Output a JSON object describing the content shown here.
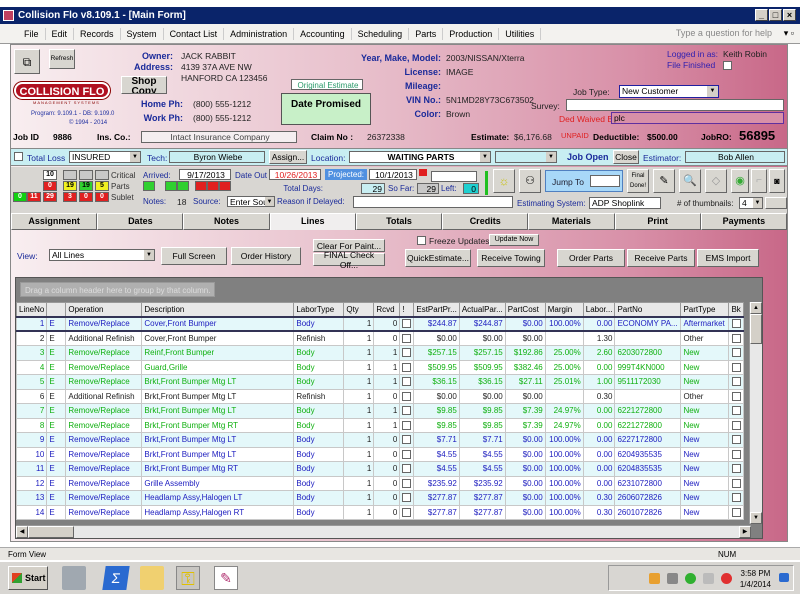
{
  "window": {
    "title": "Collision Flo v8.109.1 - [Main Form]",
    "controls": [
      "_",
      "□",
      "×"
    ]
  },
  "menu": {
    "items": [
      "File",
      "Edit",
      "Records",
      "System",
      "Contact List",
      "Administration",
      "Accounting",
      "Scheduling",
      "Parts",
      "Production",
      "Utilities"
    ],
    "help_placeholder": "Type a question for help"
  },
  "header": {
    "refresh_label": "Refresh",
    "shop_copy_label": "Shop Copy",
    "logo_text": "COLLISION FLO",
    "logo_sub": "MANAGEMENT SYSTEMS",
    "program_info": "Program: 9.109.1 - DB: 9.109.0",
    "copyright": "© 1994 - 2014",
    "owner_label": "Owner:",
    "owner": "JACK RABBIT",
    "address_label": "Address:",
    "address1": "4139 37A AVE NW",
    "address2": "HANFORD CA 123456",
    "home_ph_label": "Home Ph:",
    "home_ph": "(800) 555-1212",
    "work_ph_label": "Work Ph:",
    "work_ph": "(800) 555-1212",
    "job_id_label": "Job ID",
    "job_id": "9886",
    "ins_co_label": "Ins. Co.:",
    "ins_co": "Intact Insurance Company",
    "original_estimate_label": "Original Estimate",
    "date_promised_label": "Date Promised",
    "ymm_label": "Year, Make, Model:",
    "ymm": "2003/NISSAN/Xterra",
    "license_label": "License:",
    "license": "IMAGE",
    "mileage_label": "Mileage:",
    "mileage": "",
    "vin_label": "VIN No.:",
    "vin": "5N1MD28Y73C673502",
    "color_label": "Color:",
    "color": "Brown",
    "claim_label": "Claim No :",
    "claim": "26372338",
    "estimate_label": "Estimate:",
    "estimate": "$6,176.68",
    "unpaid": "UNPAID",
    "deductible_label": "Deductible:",
    "deductible": "$500.00",
    "jobro_label": "JobRO:",
    "jobro": "56895",
    "logged_in_label": "Logged in as:",
    "logged_in_user": "Keith Robin",
    "file_finished_label": "File Finished",
    "job_type_label": "Job Type:",
    "job_type": "New Customer",
    "survey_label": "Survey:",
    "survey": "",
    "ded_waived_label": "Ded Waived By:",
    "ded_waived": "plc"
  },
  "status_band": {
    "total_loss_label": "Total Loss",
    "insured": "INSURED",
    "tech_label": "Tech:",
    "tech": "Byron Wiebe",
    "assign_label": "Assign...",
    "location_label": "Location:",
    "location": "WAITING PARTS",
    "location2": "",
    "job_open": "Job Open",
    "close_label": "Close",
    "estimator_label": "Estimator:",
    "estimator": "Bob Allen"
  },
  "counts": {
    "top": "10",
    "red1": "0",
    "green": "0",
    "red2": "11",
    "red3": "29",
    "yellow": [
      "19",
      "19",
      "5"
    ],
    "red_row": [
      "3",
      "0",
      "0"
    ],
    "critical_label": "Critical",
    "parts_label": "Parts",
    "sublet_label": "Sublet"
  },
  "dates": {
    "arrived_label": "Arrived:",
    "arrived": "9/17/2013",
    "date_out_label": "Date Out",
    "date_out": "10/26/2013",
    "projected_label": "Projected:",
    "projected": "10/1/2013",
    "notes_label": "Notes:",
    "notes": "18",
    "source_label": "Source:",
    "source": "Enter Sou",
    "reason_label": "Reason if Delayed:",
    "total_days_label": "Total Days:",
    "total_days": "29",
    "so_far_label": "So Far:",
    "so_far": "29",
    "left_label": "Left:",
    "left": "0",
    "jump_to_label": "Jump To",
    "final_done_label": "Final Done!",
    "estimating_system_label": "Estimating System:",
    "estimating_system": "ADP Shoplink",
    "thumbnails_label": "# of thumbnails:",
    "thumbnails": "4"
  },
  "tabs": [
    "Assignment",
    "Dates",
    "Notes",
    "Lines",
    "Totals",
    "Credits",
    "Materials",
    "Print",
    "Payments"
  ],
  "lines_toolbar": {
    "view_label": "View:",
    "view": "All Lines",
    "full_screen": "Full Screen",
    "order_history": "Order History",
    "clear_for_paint": "Clear For Paint...",
    "final_check_off": "FINAL Check Off...",
    "freeze_updates": "Freeze Updates",
    "update_now": "Update Now",
    "quick_estimate": "QuickEstimate...",
    "receive_towing": "Receive Towing",
    "order_parts": "Order Parts",
    "receive_parts": "Receive Parts",
    "ems_import": "EMS Import"
  },
  "grid": {
    "group_hint": "Drag a column header here to group by that column.",
    "columns": [
      "LineNo",
      "",
      "Operation",
      "Description",
      "LaborType",
      "Qty",
      "Rcvd",
      "!",
      "EstPartPr...",
      "ActualPar...",
      "PartCost",
      "Margin",
      "Labor...",
      "PartNo",
      "PartType",
      "Bk"
    ],
    "rows": [
      {
        "line": "1",
        "e": "E",
        "op": "Remove/Replace",
        "desc": "Cover,Front Bumper",
        "labor": "Body",
        "qty": "1",
        "rcvd": "0",
        "est": "$244.87",
        "act": "$244.87",
        "cost": "$0.00",
        "margin": "100.00%",
        "lab": "0.00",
        "partno": "ECONOMY PA...",
        "ptype": "Aftermarket",
        "color": "blue"
      },
      {
        "line": "2",
        "e": "E",
        "op": "Additional Refinish",
        "desc": "Cover,Front Bumper",
        "labor": "Refinish",
        "qty": "1",
        "rcvd": "0",
        "est": "$0.00",
        "act": "$0.00",
        "cost": "$0.00",
        "margin": "",
        "lab": "1.30",
        "partno": "",
        "ptype": "Other",
        "color": "black"
      },
      {
        "line": "3",
        "e": "E",
        "op": "Remove/Replace",
        "desc": "Reinf,Front Bumper",
        "labor": "Body",
        "qty": "1",
        "rcvd": "1",
        "est": "$257.15",
        "act": "$257.15",
        "cost": "$192.86",
        "margin": "25.00%",
        "lab": "2.60",
        "partno": "6203072800",
        "ptype": "New",
        "color": "green"
      },
      {
        "line": "4",
        "e": "E",
        "op": "Remove/Replace",
        "desc": "Guard,Grille",
        "labor": "Body",
        "qty": "1",
        "rcvd": "1",
        "est": "$509.95",
        "act": "$509.95",
        "cost": "$382.46",
        "margin": "25.00%",
        "lab": "0.00",
        "partno": "999T4KN000",
        "ptype": "New",
        "color": "green"
      },
      {
        "line": "5",
        "e": "E",
        "op": "Remove/Replace",
        "desc": "Brkt,Front Bumper Mtg  LT",
        "labor": "Body",
        "qty": "1",
        "rcvd": "1",
        "est": "$36.15",
        "act": "$36.15",
        "cost": "$27.11",
        "margin": "25.01%",
        "lab": "1.00",
        "partno": "9511172030",
        "ptype": "New",
        "color": "green"
      },
      {
        "line": "6",
        "e": "E",
        "op": "Additional Refinish",
        "desc": "Brkt,Front Bumper Mtg  LT",
        "labor": "Refinish",
        "qty": "1",
        "rcvd": "0",
        "est": "$0.00",
        "act": "$0.00",
        "cost": "$0.00",
        "margin": "",
        "lab": "0.30",
        "partno": "",
        "ptype": "Other",
        "color": "black"
      },
      {
        "line": "7",
        "e": "E",
        "op": "Remove/Replace",
        "desc": "Brkt,Front Bumper Mtg  LT",
        "labor": "Body",
        "qty": "1",
        "rcvd": "1",
        "est": "$9.85",
        "act": "$9.85",
        "cost": "$7.39",
        "margin": "24.97%",
        "lab": "0.00",
        "partno": "6221272800",
        "ptype": "New",
        "color": "green"
      },
      {
        "line": "8",
        "e": "E",
        "op": "Remove/Replace",
        "desc": "Brkt,Front Bumper Mtg  RT",
        "labor": "Body",
        "qty": "1",
        "rcvd": "1",
        "est": "$9.85",
        "act": "$9.85",
        "cost": "$7.39",
        "margin": "24.97%",
        "lab": "0.00",
        "partno": "6221272800",
        "ptype": "New",
        "color": "green"
      },
      {
        "line": "9",
        "e": "E",
        "op": "Remove/Replace",
        "desc": "Brkt,Front Bumper Mtg  LT",
        "labor": "Body",
        "qty": "1",
        "rcvd": "0",
        "est": "$7.71",
        "act": "$7.71",
        "cost": "$0.00",
        "margin": "100.00%",
        "lab": "0.00",
        "partno": "6227172800",
        "ptype": "New",
        "color": "blue"
      },
      {
        "line": "10",
        "e": "E",
        "op": "Remove/Replace",
        "desc": "Brkt,Front Bumper Mtg  LT",
        "labor": "Body",
        "qty": "1",
        "rcvd": "0",
        "est": "$4.55",
        "act": "$4.55",
        "cost": "$0.00",
        "margin": "100.00%",
        "lab": "0.00",
        "partno": "6204935535",
        "ptype": "New",
        "color": "blue"
      },
      {
        "line": "11",
        "e": "E",
        "op": "Remove/Replace",
        "desc": "Brkt,Front Bumper Mtg  RT",
        "labor": "Body",
        "qty": "1",
        "rcvd": "0",
        "est": "$4.55",
        "act": "$4.55",
        "cost": "$0.00",
        "margin": "100.00%",
        "lab": "0.00",
        "partno": "6204835535",
        "ptype": "New",
        "color": "blue"
      },
      {
        "line": "12",
        "e": "E",
        "op": "Remove/Replace",
        "desc": "Grille Assembly",
        "labor": "Body",
        "qty": "1",
        "rcvd": "0",
        "est": "$235.92",
        "act": "$235.92",
        "cost": "$0.00",
        "margin": "100.00%",
        "lab": "0.00",
        "partno": "6231072800",
        "ptype": "New",
        "color": "blue"
      },
      {
        "line": "13",
        "e": "E",
        "op": "Remove/Replace",
        "desc": "Headlamp Assy,Halogen  LT",
        "labor": "Body",
        "qty": "1",
        "rcvd": "0",
        "est": "$277.87",
        "act": "$277.87",
        "cost": "$0.00",
        "margin": "100.00%",
        "lab": "0.30",
        "partno": "2606072826",
        "ptype": "New",
        "color": "blue"
      },
      {
        "line": "14",
        "e": "E",
        "op": "Remove/Replace",
        "desc": "Headlamp Assy,Halogen  RT",
        "labor": "Body",
        "qty": "1",
        "rcvd": "0",
        "est": "$277.87",
        "act": "$277.87",
        "cost": "$0.00",
        "margin": "100.00%",
        "lab": "0.30",
        "partno": "2601072826",
        "ptype": "New",
        "color": "blue"
      }
    ]
  },
  "statusbar": {
    "left": "Form View",
    "num": "NUM"
  },
  "taskbar": {
    "start": "Start",
    "time": "3:58 PM",
    "date": "1/4/2014"
  },
  "colors": {
    "title": "#0a246a",
    "blue_text": "#2020c0",
    "green_text": "#10b010",
    "red": "#e02020"
  }
}
